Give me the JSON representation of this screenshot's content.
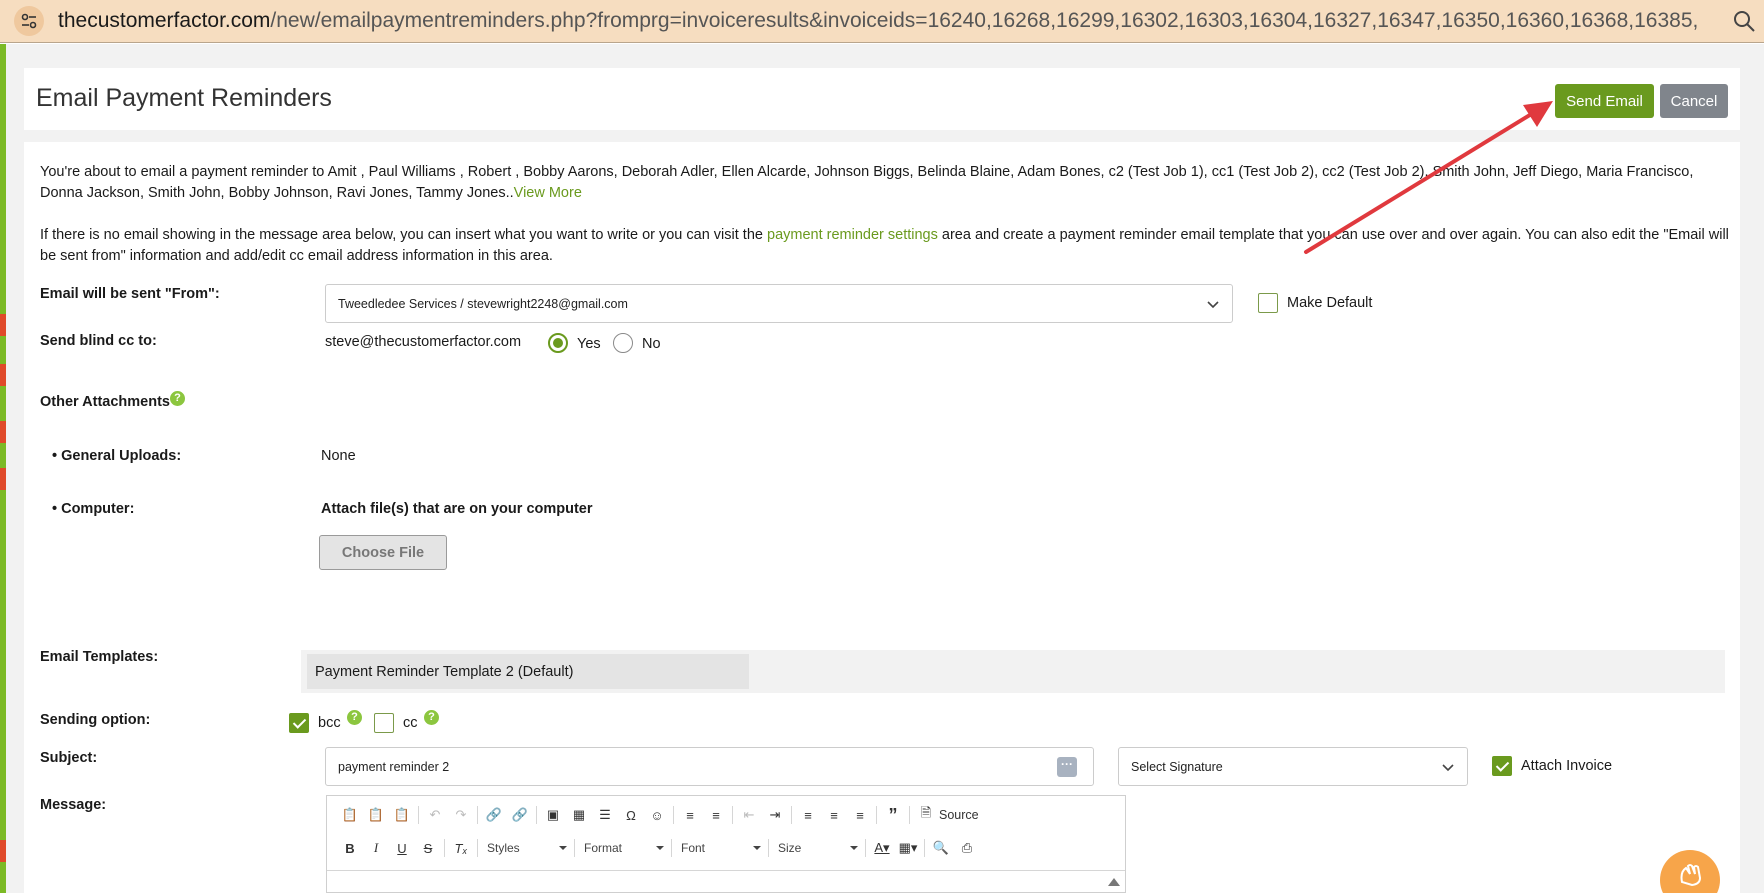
{
  "browser": {
    "url_host": "thecustomerfactor.com",
    "url_rest": "/new/emailpaymentreminders.php?fromprg=invoiceresults&invoiceids=16240,16268,16299,16302,16303,16304,16327,16347,16350,16360,16368,16385,16..."
  },
  "header": {
    "title": "Email Payment Reminders",
    "send_label": "Send Email",
    "cancel_label": "Cancel"
  },
  "intro": {
    "recipients_text": "You're about to email a payment reminder to Amit , Paul Williams , Robert , Bobby Aarons, Deborah Adler, Ellen Alcarde, Johnson Biggs, Belinda Blaine, Adam Bones, c2 (Test Job 1), cc1 (Test Job 2), cc2 (Test Job 2), Smith John, Jeff Diego, Maria Francisco, Donna Jackson, Smith John, Bobby Johnson, Ravi Jones, Tammy Jones..",
    "view_more": "View More",
    "info_before": "If there is no email showing in the message area below, you can insert what you want to write or you can visit the ",
    "info_link": "payment reminder settings",
    "info_after": " area and create a payment reminder email template that you can use over and over again. You can also edit the \"Email will be sent from\" information and add/edit cc email address information in this area."
  },
  "from": {
    "label": "Email will be sent \"From\":",
    "value": "Tweedledee Services / stevewright2248@gmail.com",
    "make_default_label": "Make Default",
    "make_default_checked": false
  },
  "blind_cc": {
    "label": "Send blind cc to:",
    "email": "steve@thecustomerfactor.com",
    "yes_label": "Yes",
    "no_label": "No",
    "selected": "Yes"
  },
  "attachments": {
    "title": "Other Attachments",
    "general_label": "• General Uploads:",
    "general_value": "None",
    "computer_label": "• Computer:",
    "computer_text": "Attach file(s) that are on your computer",
    "choose_file_label": "Choose File"
  },
  "templates": {
    "label": "Email Templates:",
    "selected": "Payment Reminder Template 2 (Default)"
  },
  "sending_option": {
    "label": "Sending option:",
    "bcc_label": "bcc",
    "bcc_checked": true,
    "cc_label": "cc",
    "cc_checked": false
  },
  "subject": {
    "label": "Subject:",
    "value": "payment reminder 2",
    "signature_placeholder": "Select Signature",
    "attach_invoice_label": "Attach Invoice",
    "attach_invoice_checked": true
  },
  "message": {
    "label": "Message:",
    "source_label": "Source",
    "styles_label": "Styles",
    "format_label": "Format",
    "font_label": "Font",
    "size_label": "Size"
  },
  "colors": {
    "accent_green": "#6a9a1e",
    "cancel_gray": "#80858c",
    "arrow_red": "#e0393e"
  }
}
